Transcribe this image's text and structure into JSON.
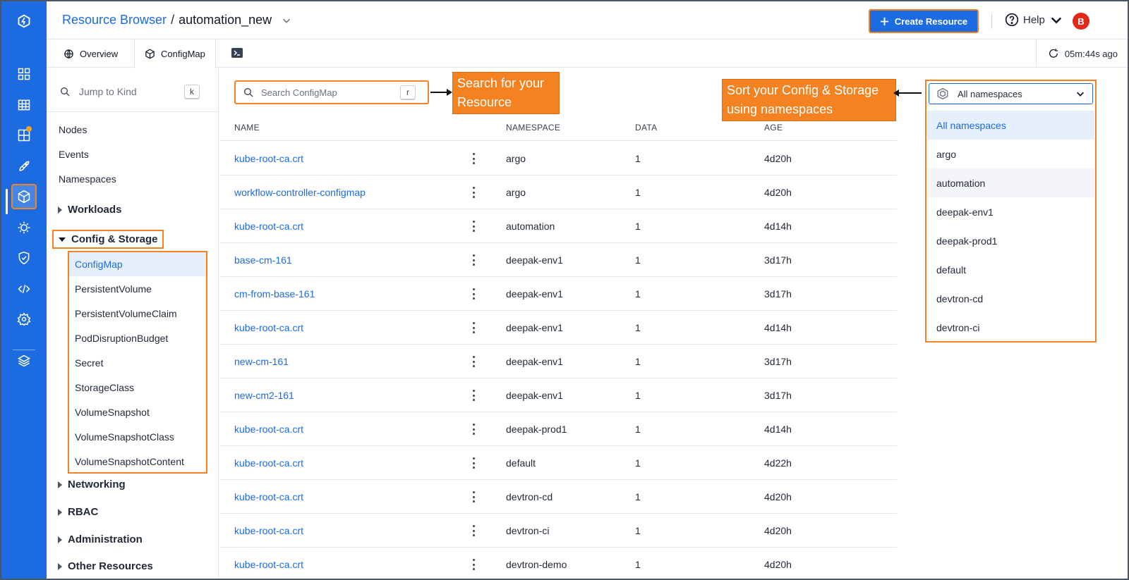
{
  "header": {
    "breadcrumb_root": "Resource Browser",
    "breadcrumb_sep": "/",
    "cluster": "automation_new",
    "create_button": "Create Resource",
    "help": "Help",
    "avatar_initial": "B"
  },
  "tabs": [
    {
      "label": "Overview",
      "icon": "globe-icon"
    },
    {
      "label": "ConfigMap",
      "icon": "cube-icon"
    }
  ],
  "sync_text": "05m:44s ago",
  "sidebar": {
    "jump_placeholder": "Jump to Kind",
    "jump_shortcut": "k",
    "top_items": [
      "Nodes",
      "Events",
      "Namespaces"
    ],
    "groups": {
      "workloads": "Workloads",
      "config_storage": "Config & Storage",
      "networking": "Networking",
      "rbac": "RBAC",
      "administration": "Administration",
      "other": "Other Resources"
    },
    "config_items": [
      "ConfigMap",
      "PersistentVolume",
      "PersistentVolumeClaim",
      "PodDisruptionBudget",
      "Secret",
      "StorageClass",
      "VolumeSnapshot",
      "VolumeSnapshotClass",
      "VolumeSnapshotContent"
    ]
  },
  "search": {
    "placeholder": "Search ConfigMap",
    "shortcut": "r"
  },
  "callouts": {
    "search": "Search for your Resource",
    "sort": "Sort your Config & Storage using namespaces"
  },
  "table": {
    "columns": [
      "NAME",
      "NAMESPACE",
      "DATA",
      "AGE"
    ],
    "rows": [
      {
        "name": "kube-root-ca.crt",
        "namespace": "argo",
        "data": "1",
        "age": "4d20h"
      },
      {
        "name": "workflow-controller-configmap",
        "namespace": "argo",
        "data": "1",
        "age": "4d20h"
      },
      {
        "name": "kube-root-ca.crt",
        "namespace": "automation",
        "data": "1",
        "age": "4d14h"
      },
      {
        "name": "base-cm-161",
        "namespace": "deepak-env1",
        "data": "1",
        "age": "3d17h"
      },
      {
        "name": "cm-from-base-161",
        "namespace": "deepak-env1",
        "data": "1",
        "age": "3d17h"
      },
      {
        "name": "kube-root-ca.crt",
        "namespace": "deepak-env1",
        "data": "1",
        "age": "4d14h"
      },
      {
        "name": "new-cm-161",
        "namespace": "deepak-env1",
        "data": "1",
        "age": "3d17h"
      },
      {
        "name": "new-cm2-161",
        "namespace": "deepak-env1",
        "data": "1",
        "age": "3d17h"
      },
      {
        "name": "kube-root-ca.crt",
        "namespace": "deepak-prod1",
        "data": "1",
        "age": "4d14h"
      },
      {
        "name": "kube-root-ca.crt",
        "namespace": "default",
        "data": "1",
        "age": "4d22h"
      },
      {
        "name": "kube-root-ca.crt",
        "namespace": "devtron-cd",
        "data": "1",
        "age": "4d20h"
      },
      {
        "name": "kube-root-ca.crt",
        "namespace": "devtron-ci",
        "data": "1",
        "age": "4d20h"
      },
      {
        "name": "kube-root-ca.crt",
        "namespace": "devtron-demo",
        "data": "1",
        "age": "4d20h"
      }
    ]
  },
  "namespace_select": {
    "value": "All namespaces",
    "options": [
      "All namespaces",
      "argo",
      "automation",
      "deepak-env1",
      "deepak-prod1",
      "default",
      "devtron-cd",
      "devtron-ci"
    ]
  },
  "colors": {
    "brand": "#1c6be0",
    "highlight": "#f58220",
    "avatar": "#e0291b"
  }
}
